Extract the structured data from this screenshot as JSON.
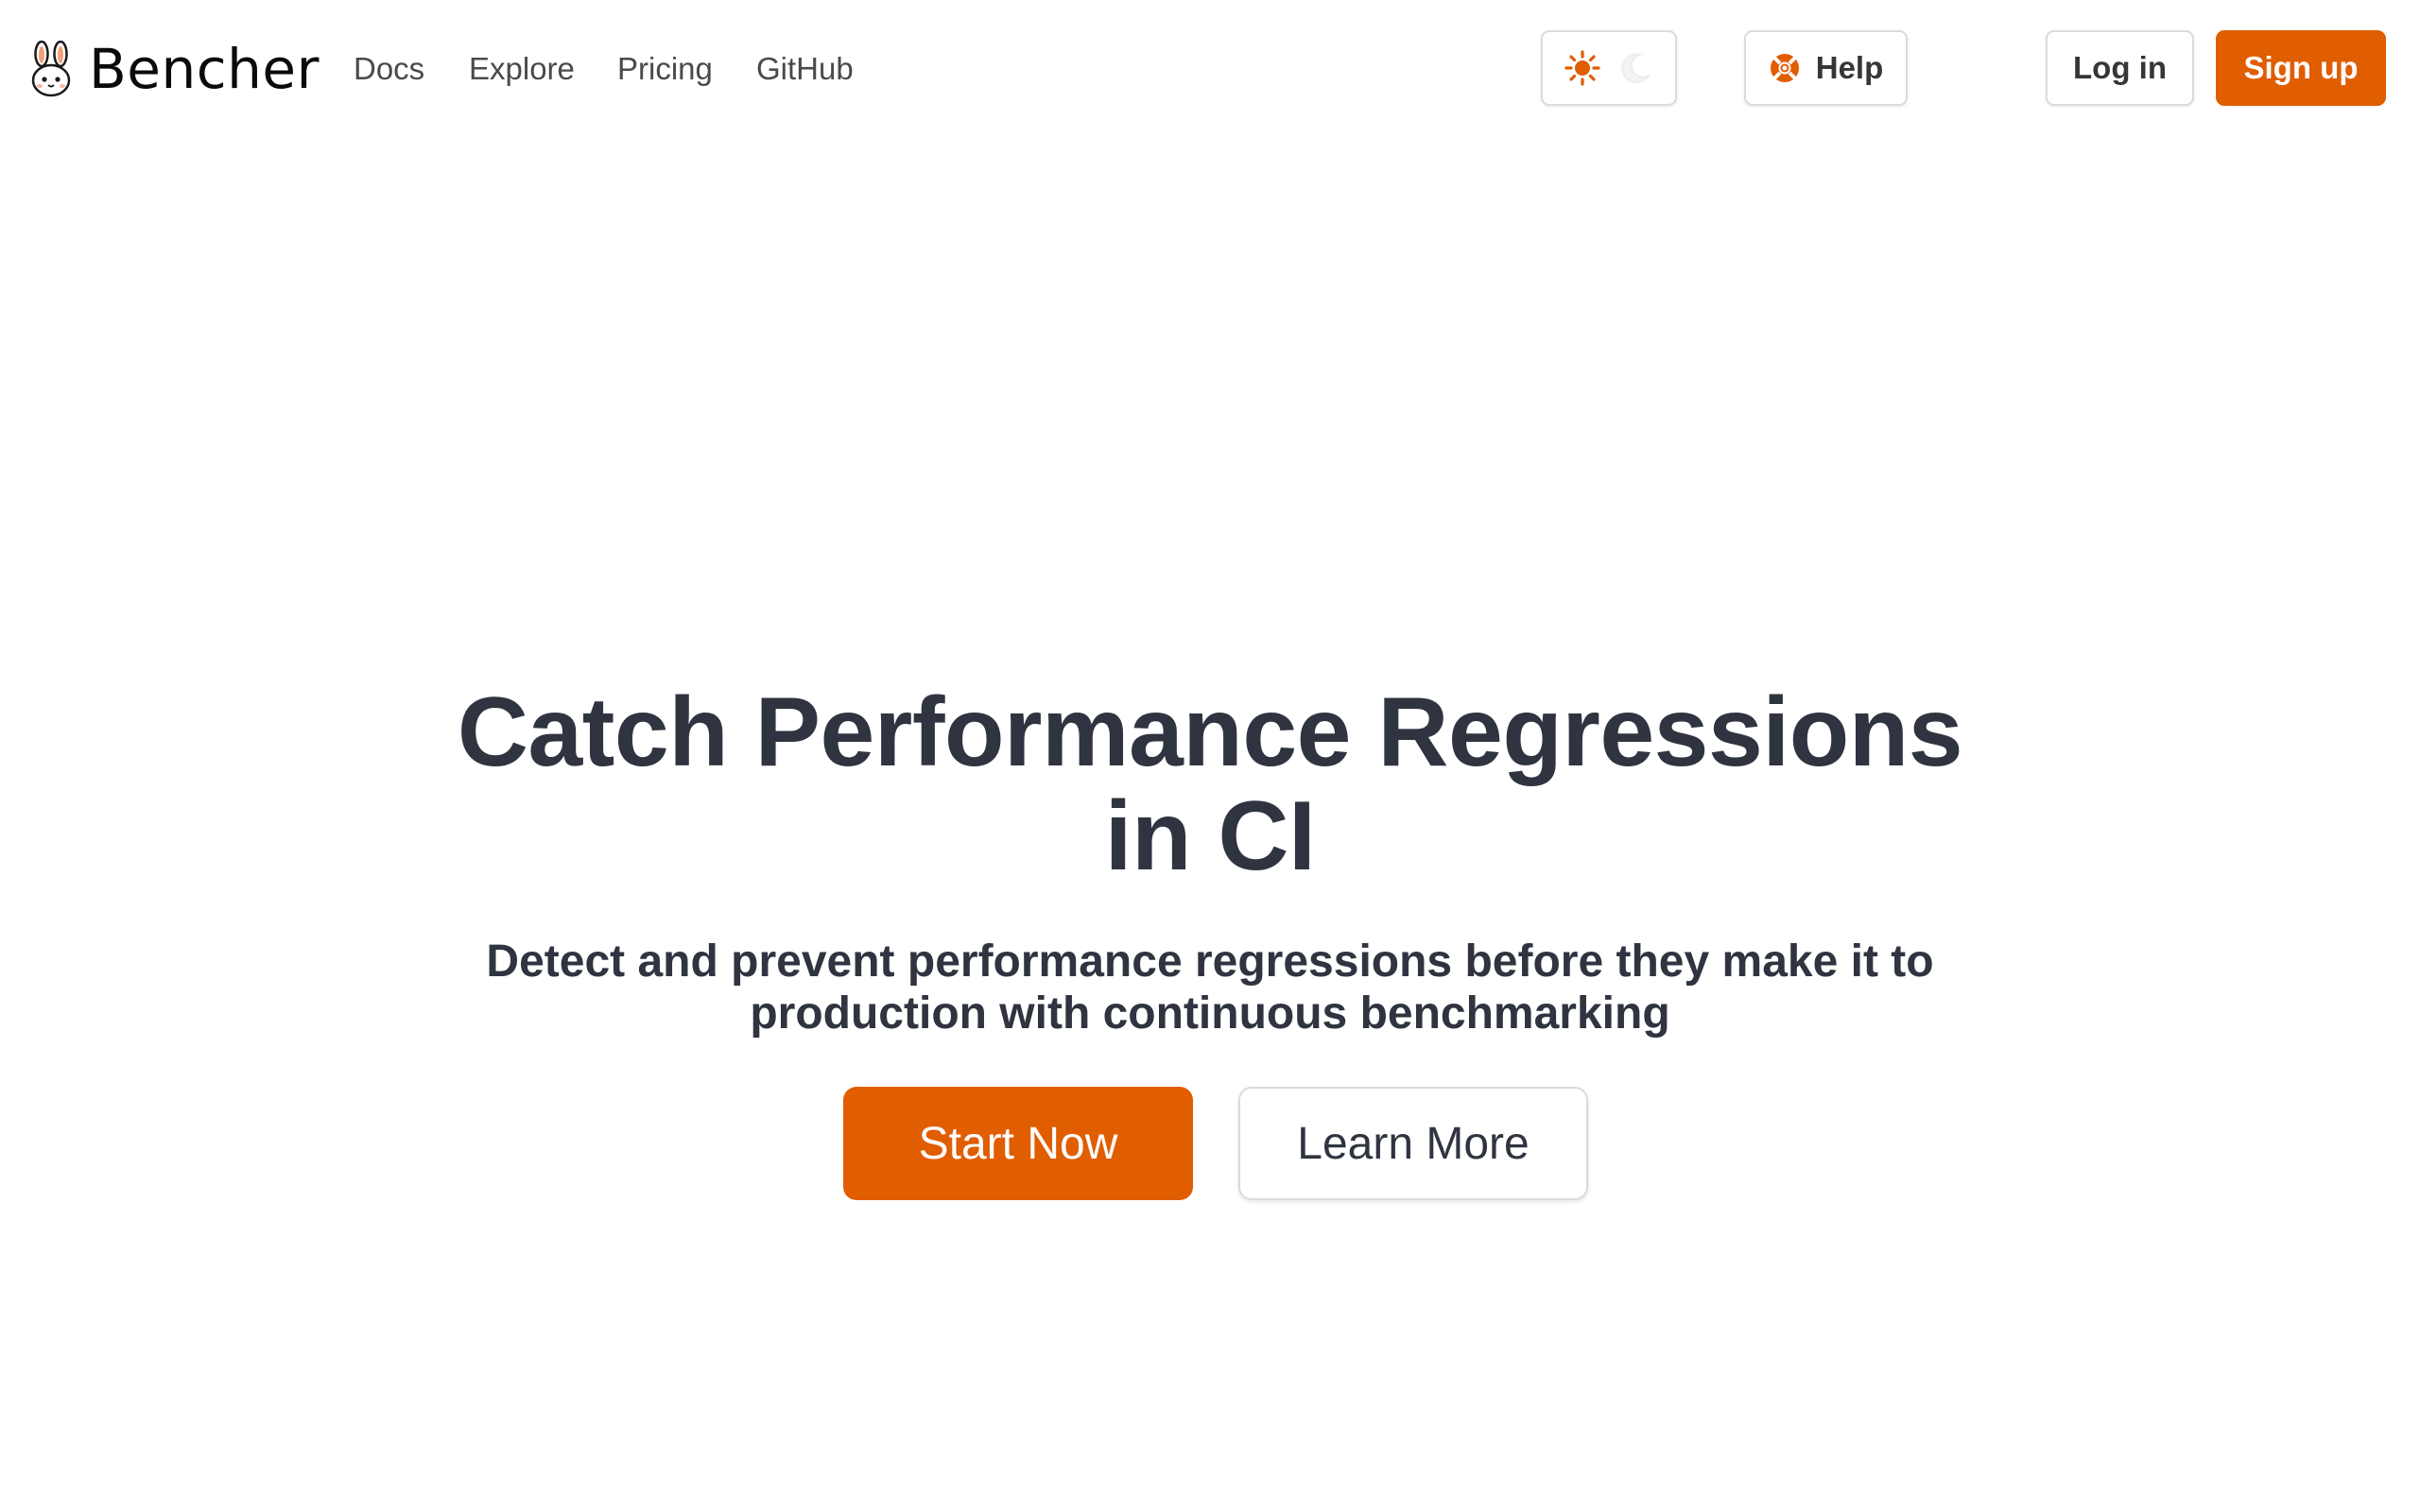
{
  "brand": {
    "name": "Bencher",
    "logo_icon": "rabbit-logo-icon"
  },
  "nav": {
    "links": [
      {
        "label": "Docs"
      },
      {
        "label": "Explore"
      },
      {
        "label": "Pricing"
      },
      {
        "label": "GitHub"
      }
    ]
  },
  "header": {
    "theme_toggle": {
      "light_icon": "sun-icon",
      "dark_icon": "moon-icon",
      "active": "light"
    },
    "help": {
      "label": "Help",
      "icon": "lifebuoy-icon"
    },
    "login": {
      "label": "Log in"
    },
    "signup": {
      "label": "Sign up"
    }
  },
  "hero": {
    "title": "Catch Performance Regressions in CI",
    "subtitle": "Detect and prevent performance regressions before they make it to production with continuous benchmarking",
    "primary_cta": "Start Now",
    "secondary_cta": "Learn More"
  },
  "colors": {
    "accent": "#e05d00",
    "text_dark": "#2f3440",
    "border": "#dbdbdb"
  }
}
